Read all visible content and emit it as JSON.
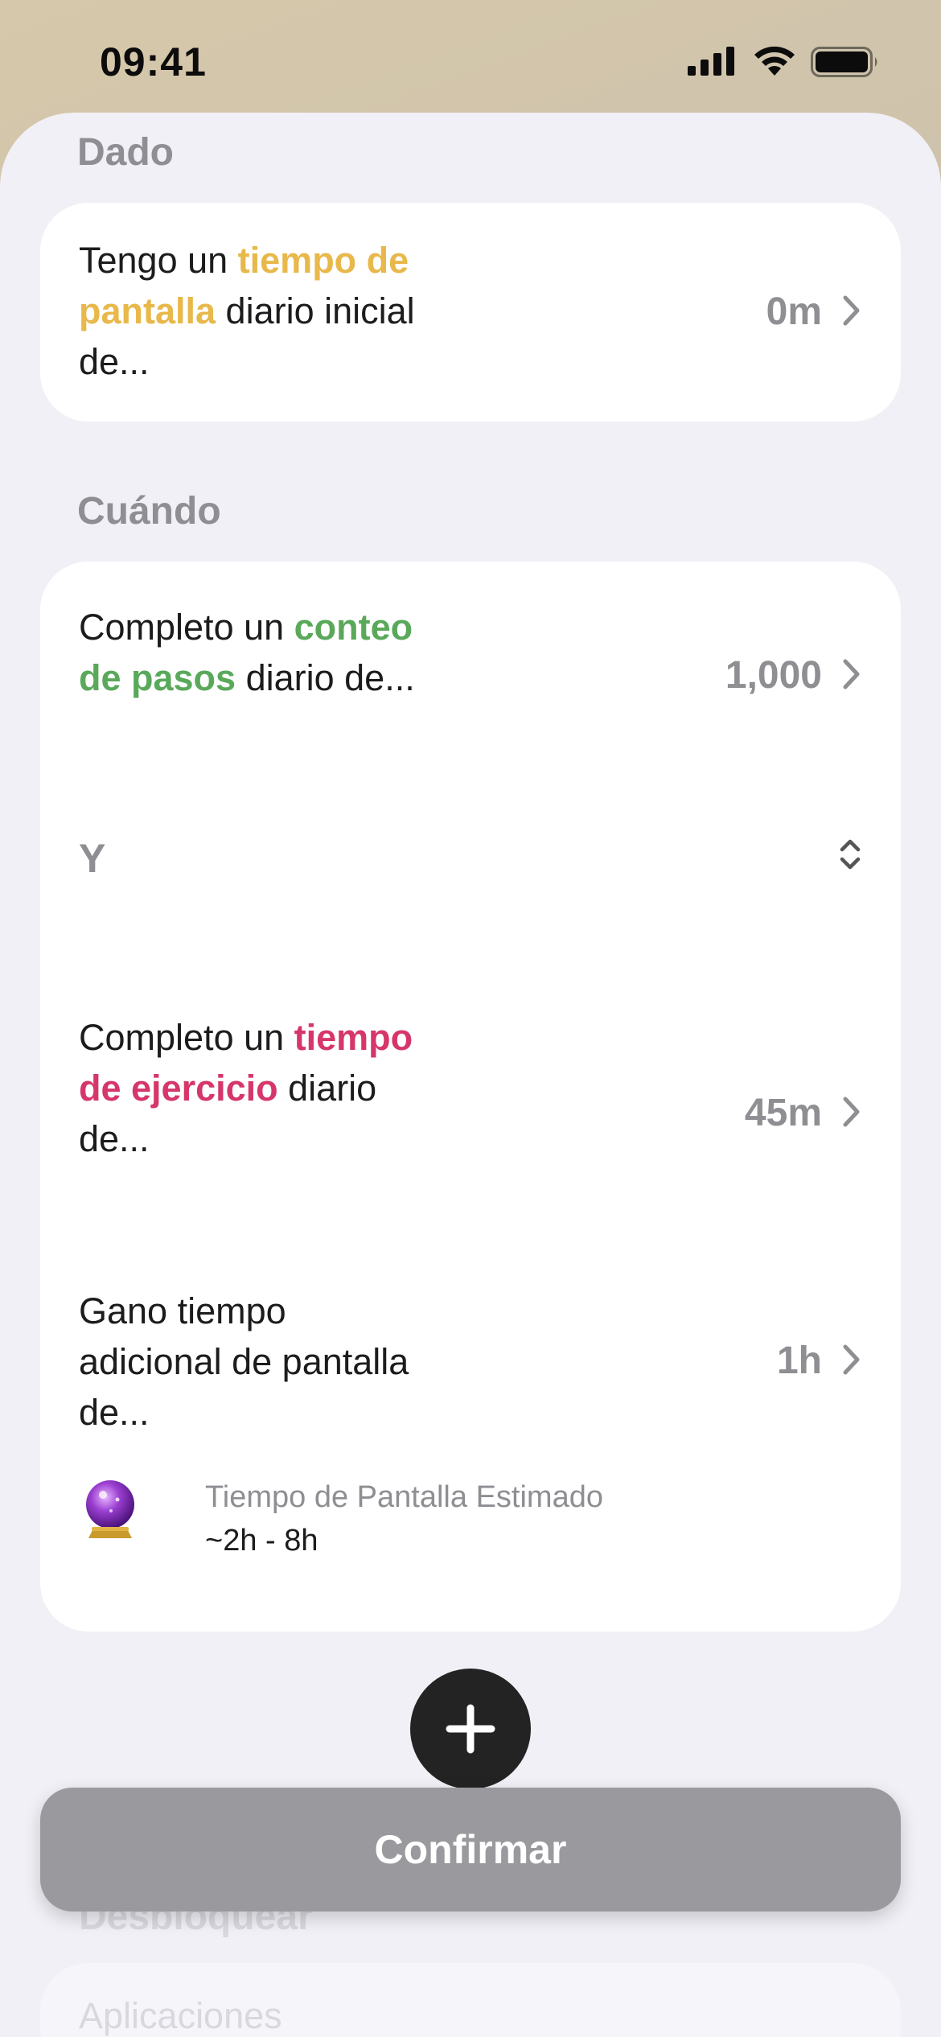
{
  "status_bar": {
    "time": "09:41"
  },
  "sections": {
    "given": "Dado",
    "when": "Cuándo",
    "unlock": "Desbloquear",
    "apps": "Aplicaciones"
  },
  "given_row": {
    "prefix": "Tengo un ",
    "highlight": "tiempo de pantalla",
    "suffix": " diario inicial de...",
    "value": "0m",
    "highlight_color": "#e8b84a"
  },
  "steps_row": {
    "prefix": "Completo un ",
    "highlight": "conteo de pasos",
    "suffix": " diario de...",
    "value": "1,000",
    "highlight_color": "#5aa95b"
  },
  "operator": {
    "label": "Y"
  },
  "exercise_row": {
    "prefix": "Completo un ",
    "highlight": "tiempo de ejercicio",
    "suffix": " diario de...",
    "value": "45m",
    "highlight_color": "#d6366a"
  },
  "reward_row": {
    "text": "Gano tiempo adicional de pantalla de...",
    "value": "1h"
  },
  "estimate": {
    "icon": "crystal-ball-icon",
    "title": "Tiempo de Pantalla Estimado",
    "value": "~2h - 8h"
  },
  "add_button": {
    "icon": "plus-icon"
  },
  "confirm_button": {
    "label": "Confirmar"
  }
}
